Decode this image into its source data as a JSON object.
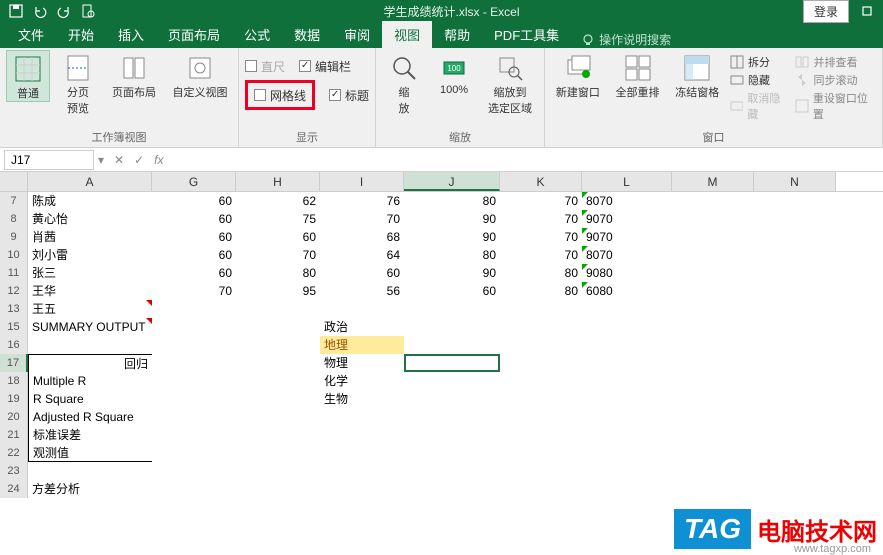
{
  "qat": {
    "title": "学生成绩统计.xlsx - Excel",
    "login": "登录"
  },
  "tabs": {
    "file": "文件",
    "home": "开始",
    "insert": "插入",
    "layout": "页面布局",
    "formulas": "公式",
    "data": "数据",
    "review": "审阅",
    "view": "视图",
    "help": "帮助",
    "pdf": "PDF工具集",
    "tellme": "操作说明搜索"
  },
  "ribbon": {
    "views": {
      "normal": "普通",
      "pagebreak": "分页\n预览",
      "pagelayout": "页面布局",
      "custom": "自定义视图",
      "group": "工作簿视图"
    },
    "show": {
      "ruler": "直尺",
      "formula_bar": "编辑栏",
      "gridlines": "网格线",
      "headings": "标题",
      "group": "显示"
    },
    "zoom": {
      "zoom": "缩\n放",
      "hundred": "100%",
      "selection": "缩放到\n选定区域",
      "group": "缩放"
    },
    "window": {
      "new": "新建窗口",
      "arrange": "全部重排",
      "freeze": "冻结窗格",
      "split": "拆分",
      "hide": "隐藏",
      "unhide": "取消隐藏",
      "side": "并排查看",
      "sync": "同步滚动",
      "reset": "重设窗口位置",
      "group": "窗口"
    }
  },
  "namebox": {
    "ref": "J17",
    "fx": "fx"
  },
  "columns": [
    "A",
    "G",
    "H",
    "I",
    "J",
    "K",
    "L",
    "M",
    "N"
  ],
  "data_rows": [
    {
      "n": "7",
      "a": "陈成",
      "g": "60",
      "h": "62",
      "i": "76",
      "j": "80",
      "k": "70",
      "l": "8070"
    },
    {
      "n": "8",
      "a": "黄心怡",
      "g": "60",
      "h": "75",
      "i": "70",
      "j": "90",
      "k": "70",
      "l": "9070"
    },
    {
      "n": "9",
      "a": "肖茜",
      "g": "60",
      "h": "60",
      "i": "68",
      "j": "90",
      "k": "70",
      "l": "9070"
    },
    {
      "n": "10",
      "a": "刘小雷",
      "g": "60",
      "h": "70",
      "i": "64",
      "j": "80",
      "k": "70",
      "l": "8070"
    },
    {
      "n": "11",
      "a": "张三",
      "g": "60",
      "h": "80",
      "i": "60",
      "j": "90",
      "k": "80",
      "l": "9080"
    },
    {
      "n": "12",
      "a": "王华",
      "g": "70",
      "h": "95",
      "i": "56",
      "j": "60",
      "k": "80",
      "l": "6080"
    }
  ],
  "labels": {
    "r13": "王五",
    "r15": "SUMMARY OUTPUT",
    "r17": "回归",
    "r18": "Multiple R",
    "r19": "R Square",
    "r20": "Adjusted R Square",
    "r21": "标准误差",
    "r22": "观测值",
    "r24": "方差分析"
  },
  "subjects": {
    "s15": "政治",
    "s16": "地理",
    "s17": "物理",
    "s18": "化学",
    "s19": "生物"
  },
  "footer": {
    "tag": "TAG",
    "text": "电脑技术网",
    "url": "www.tagxp.com"
  }
}
